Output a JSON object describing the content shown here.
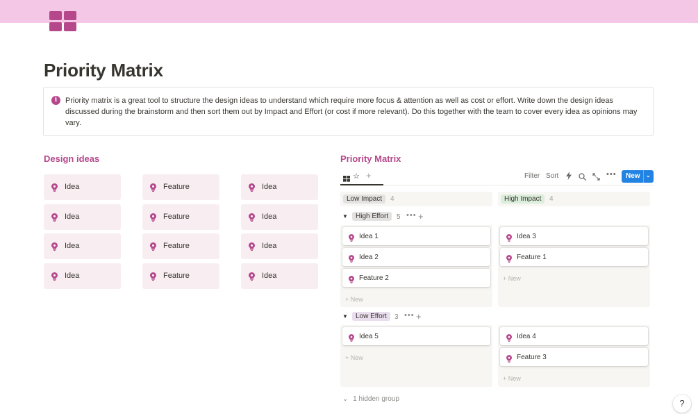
{
  "colors": {
    "banner": "#f4c7e7",
    "icon": "#b5488b",
    "accent": "#b5488b",
    "card_bg": "#f8eef2",
    "new_button": "#2383e2",
    "low_impact_tag": "#e3e2e0",
    "high_impact_tag": "#dbeddb",
    "high_effort_tag": "#e3e2e0",
    "low_effort_tag": "#e8deee"
  },
  "page": {
    "icon": "grid-icon",
    "title": "Priority Matrix"
  },
  "callout": {
    "icon": "info-icon",
    "text": "Priority matrix is a great tool to structure the design ideas to understand which require more focus & attention as well as cost or effort. Write down the design ideas discussed during the brainstorm and then sort them out by Impact and Effort (or cost if more relevant). Do this together with the team to cover every idea as opinions may vary."
  },
  "design_ideas": {
    "title": "Design ideas",
    "cards": [
      {
        "label": "Idea"
      },
      {
        "label": "Feature"
      },
      {
        "label": "Idea"
      },
      {
        "label": "Idea"
      },
      {
        "label": "Feature"
      },
      {
        "label": "Idea"
      },
      {
        "label": "Idea"
      },
      {
        "label": "Feature"
      },
      {
        "label": "Idea"
      },
      {
        "label": "Idea"
      },
      {
        "label": "Feature"
      },
      {
        "label": "Idea"
      }
    ]
  },
  "matrix": {
    "title": "Priority Matrix",
    "toolbar": {
      "filter": "Filter",
      "sort": "Sort",
      "new": "New"
    },
    "columns": [
      {
        "label": "Low Impact",
        "count": "4"
      },
      {
        "label": "High Impact",
        "count": "4"
      }
    ],
    "groups": [
      {
        "label": "High Effort",
        "count": "5",
        "low_impact": [
          "Idea 1",
          "Idea 2",
          "Feature 2"
        ],
        "high_impact": [
          "Idea 3",
          "Feature 1"
        ]
      },
      {
        "label": "Low Effort",
        "count": "3",
        "low_impact": [
          "Idea 5"
        ],
        "high_impact": [
          "Idea 4",
          "Feature 3"
        ]
      }
    ],
    "new_label": "New",
    "hidden_group": "1 hidden group"
  },
  "help": "?"
}
